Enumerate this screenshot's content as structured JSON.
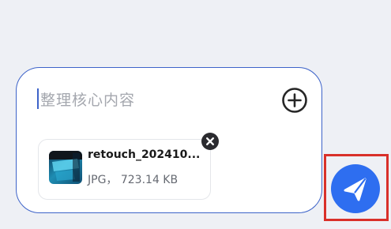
{
  "composer": {
    "placeholder": "整理核心内容"
  },
  "attachment": {
    "name": "retouch_202410...",
    "meta": "JPG， 723.14 KB"
  },
  "icons": {
    "add": "plus-circle-icon",
    "remove": "close-circle-icon",
    "send": "paper-plane-icon",
    "thumbnail": "image-thumbnail"
  },
  "colors": {
    "accent": "#2e6ef0",
    "border": "#3d63c9",
    "highlight": "#d9302a"
  }
}
